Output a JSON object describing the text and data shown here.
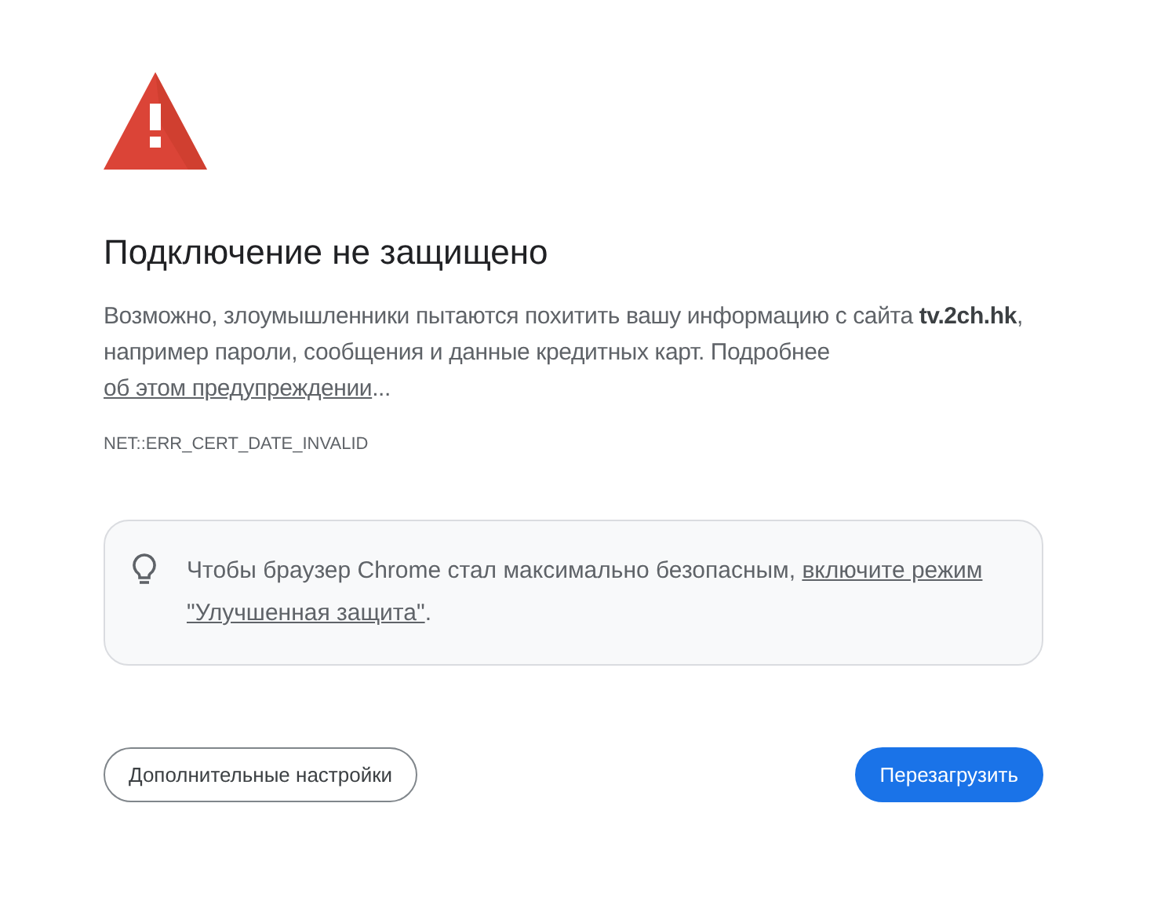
{
  "heading": "Подключение не защищено",
  "explanation": [
    {
      "kind": "text",
      "text": "Возможно, злоумышленники пытаются похитить вашу информацию с сайта **tv.2ch.hk**, например пароли, сообщения и данные кредитных карт. Подробнее "
    },
    {
      "kind": "link",
      "text": "об этом предупреждении"
    },
    {
      "kind": "text",
      "text": "..."
    }
  ],
  "error_code": "NET::ERR_CERT_DATE_INVALID",
  "tip": [
    {
      "kind": "text",
      "text": "Чтобы браузер Chrome стал максимально безопасным, "
    },
    {
      "kind": "link",
      "text": "включите режим"
    },
    {
      "kind": "link",
      "text": "\"Улучшенная защита\""
    },
    {
      "kind": "text",
      "text": "."
    }
  ],
  "buttons": [
    {
      "label": "Дополнительные настройки",
      "kind": "secondary"
    },
    {
      "label": "Перезагрузить",
      "kind": "primary"
    }
  ]
}
